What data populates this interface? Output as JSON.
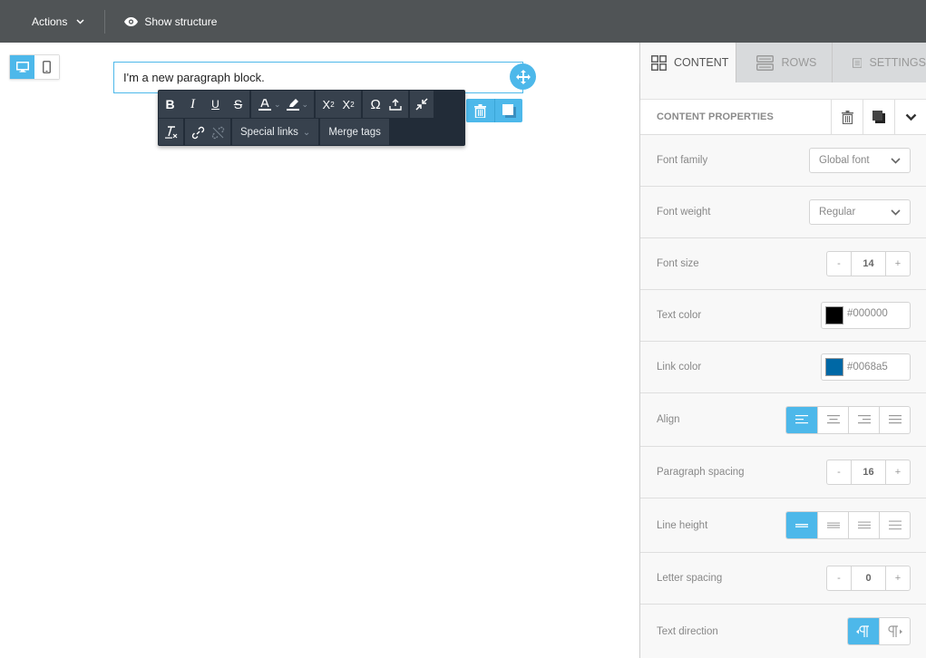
{
  "topbar": {
    "actions_label": "Actions",
    "show_structure_label": "Show structure"
  },
  "canvas": {
    "device_toggle": [
      {
        "name": "desktop",
        "active": true
      },
      {
        "name": "mobile",
        "active": false
      }
    ],
    "paragraph_text": "I'm a new paragraph block."
  },
  "toolbar": {
    "row1": [
      [
        "bold",
        "italic",
        "underline",
        "strikethrough"
      ],
      [
        "text-color",
        "highlight-color"
      ],
      [
        "superscript",
        "subscript"
      ],
      [
        "special-character",
        "upload"
      ],
      [
        "collapse"
      ]
    ],
    "row2": {
      "special_links_label": "Special links",
      "merge_tags_label": "Merge tags"
    }
  },
  "panel": {
    "tabs": [
      {
        "label": "CONTENT",
        "active": true
      },
      {
        "label": "ROWS",
        "active": false
      },
      {
        "label": "SETTINGS",
        "active": false
      }
    ],
    "header_title": "CONTENT PROPERTIES",
    "properties": {
      "font_family": {
        "label": "Font family",
        "value": "Global font"
      },
      "font_weight": {
        "label": "Font weight",
        "value": "Regular"
      },
      "font_size": {
        "label": "Font size",
        "value": "14",
        "minus": "-",
        "plus": "+"
      },
      "text_color": {
        "label": "Text color",
        "value": "#000000",
        "swatch": "#000000"
      },
      "link_color": {
        "label": "Link color",
        "value": "#0068a5",
        "swatch": "#0068a5"
      },
      "align": {
        "label": "Align",
        "options": [
          "left",
          "center",
          "right",
          "justify"
        ],
        "selected": "left"
      },
      "paragraph_spacing": {
        "label": "Paragraph spacing",
        "value": "16",
        "minus": "-",
        "plus": "+"
      },
      "line_height": {
        "label": "Line height",
        "options": [
          "single",
          "1.5",
          "double",
          "triple"
        ],
        "selected": "single"
      },
      "letter_spacing": {
        "label": "Letter spacing",
        "value": "0",
        "minus": "-",
        "plus": "+"
      },
      "text_direction": {
        "label": "Text direction",
        "options": [
          "ltr",
          "rtl"
        ],
        "selected": "ltr"
      }
    }
  },
  "colors": {
    "accent": "#4db8ea",
    "topbar": "#505456",
    "toolbar_bg": "#222c38",
    "toolbar_group": "#37414d"
  }
}
